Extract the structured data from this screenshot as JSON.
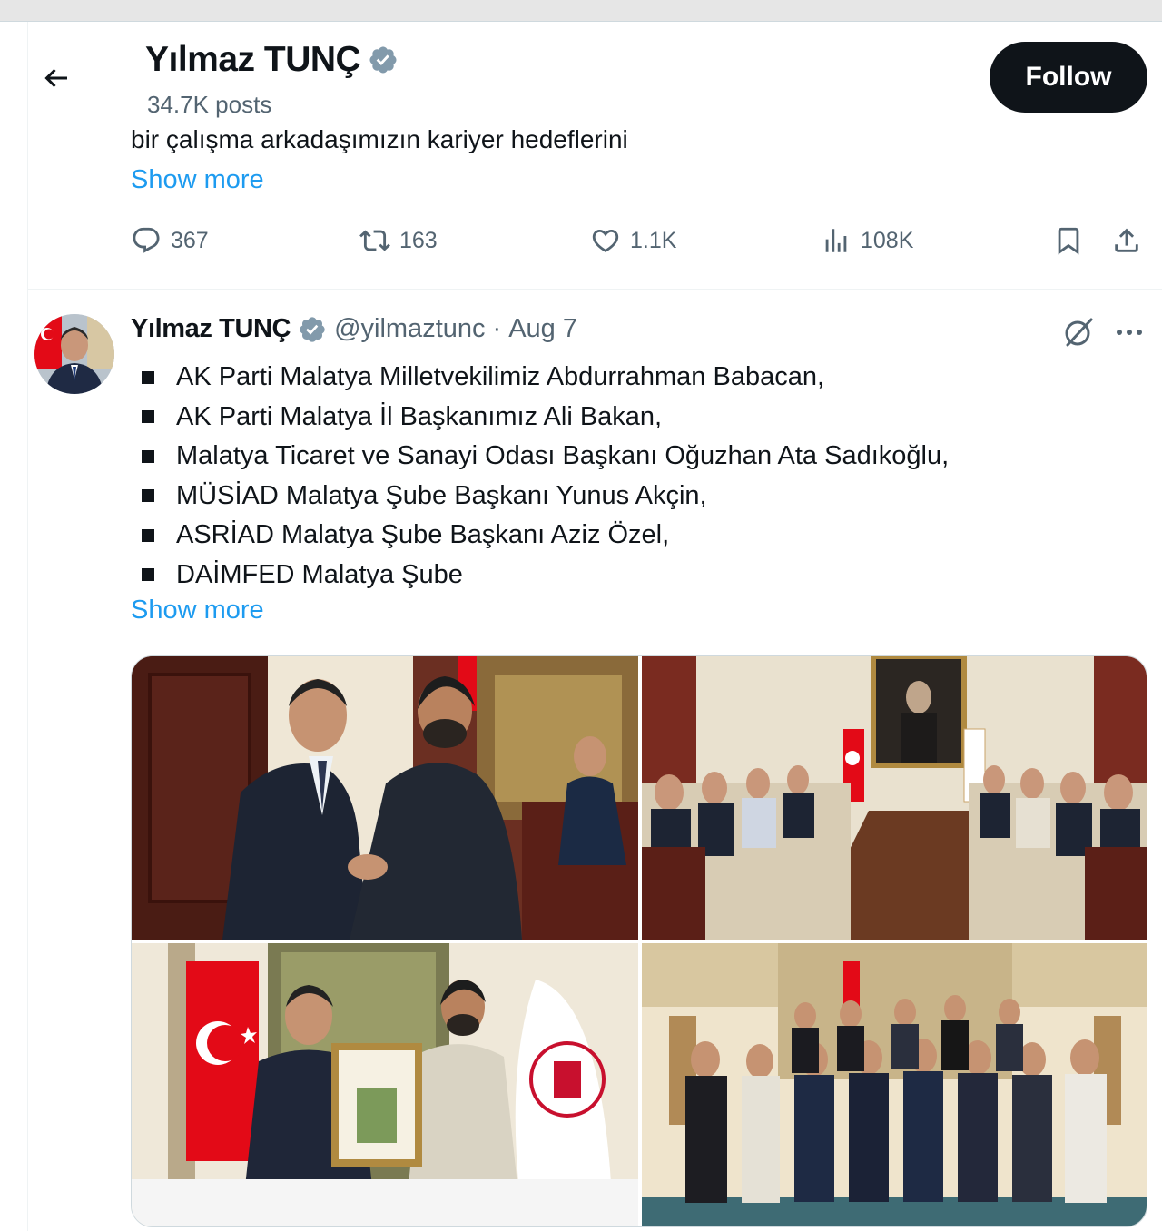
{
  "header": {
    "name": "Yılmaz TUNÇ",
    "posts": "34.7K posts",
    "follow_label": "Follow"
  },
  "prev_tweet": {
    "text": "bir çalışma arkadaşımızın kariyer hedeflerini",
    "show_more": "Show more",
    "replies": "367",
    "reposts": "163",
    "likes": "1.1K",
    "views": "108K"
  },
  "tweet": {
    "name": "Yılmaz TUNÇ",
    "handle": "@yilmaztunc",
    "separator": "·",
    "date": "Aug 7",
    "bullets": [
      "AK Parti Malatya Milletvekilimiz Abdurrahman Babacan,",
      "AK Parti Malatya İl Başkanımız Ali Bakan,",
      "Malatya Ticaret ve Sanayi Odası Başkanı Oğuzhan Ata Sadıkoğlu,",
      "MÜSİAD Malatya Şube Başkanı Yunus Akçin,",
      "ASRİAD Malatya Şube Başkanı Aziz Özel,",
      "DAİMFED Malatya Şube"
    ],
    "show_more": "Show more"
  },
  "colors": {
    "accent": "#1d9bf0",
    "text": "#0f1419",
    "muted": "#536471",
    "verified": "#829aab",
    "flag_red": "#e30a17"
  },
  "icons": [
    "back-arrow-icon",
    "verified-badge-icon",
    "reply-icon",
    "repost-icon",
    "like-icon",
    "views-icon",
    "bookmark-icon",
    "share-icon",
    "grok-icon",
    "more-icon"
  ]
}
